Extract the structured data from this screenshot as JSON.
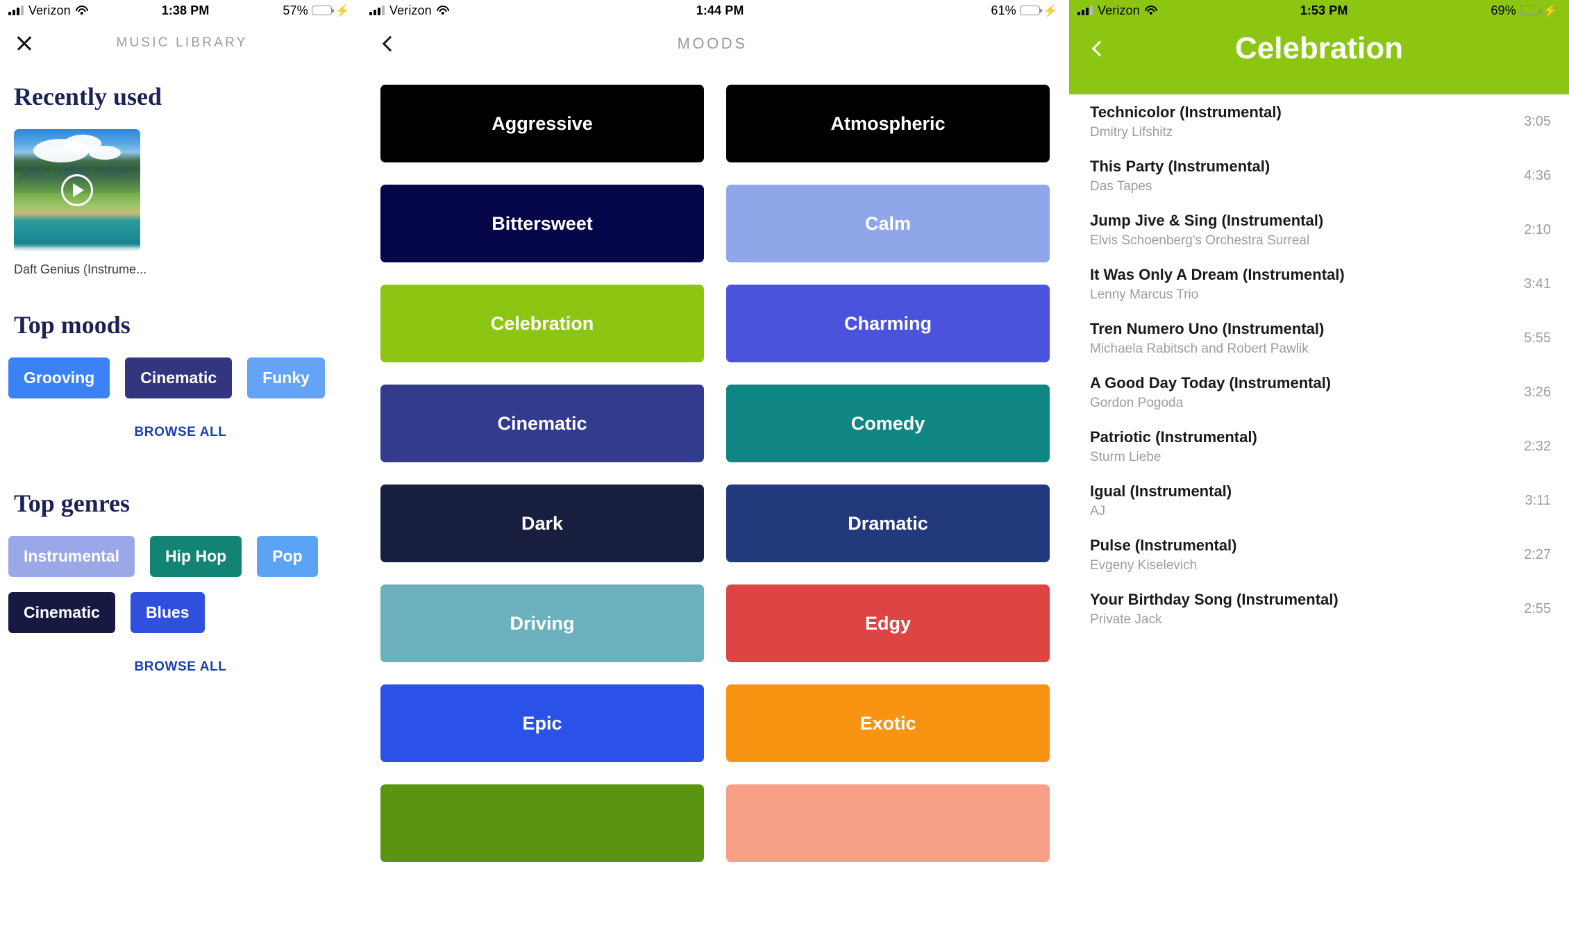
{
  "panels": {
    "library": {
      "status": {
        "carrier": "Verizon",
        "time": "1:38 PM",
        "battery": "57%",
        "battery_level": 57,
        "charging_icon": "⚡"
      },
      "nav": {
        "close_icon": "close-icon",
        "title": "MUSIC LIBRARY"
      },
      "recent": {
        "heading": "Recently used",
        "item_title": "Daft Genius (Instrume...",
        "play_icon": "play-icon"
      },
      "top_moods": {
        "heading": "Top moods",
        "browse_all": "BROWSE ALL",
        "chips": [
          {
            "label": "Grooving",
            "color": "#3b82f6"
          },
          {
            "label": "Cinematic",
            "color": "#33357e"
          },
          {
            "label": "Funky",
            "color": "#64a3f5"
          }
        ]
      },
      "top_genres": {
        "heading": "Top genres",
        "browse_all": "BROWSE ALL",
        "chips": [
          {
            "label": "Instrumental",
            "color": "#9aa8e8"
          },
          {
            "label": "Hip Hop",
            "color": "#138375"
          },
          {
            "label": "Pop",
            "color": "#5ba3f5"
          },
          {
            "label": "Cinematic",
            "color": "#161a42"
          },
          {
            "label": "Blues",
            "color": "#2f4fdc"
          }
        ]
      }
    },
    "moods": {
      "status": {
        "carrier": "Verizon",
        "time": "1:44 PM",
        "battery": "61%",
        "battery_level": 61,
        "charging_icon": "⚡"
      },
      "nav": {
        "back_icon": "chevron-left-icon",
        "title": "MOODS"
      },
      "tiles": [
        {
          "label": "Aggressive",
          "color": "#000000"
        },
        {
          "label": "Atmospheric",
          "color": "#000000"
        },
        {
          "label": "Bittersweet",
          "color": "#050549"
        },
        {
          "label": "Calm",
          "color": "#8fa7e8"
        },
        {
          "label": "Celebration",
          "color": "#8cc613"
        },
        {
          "label": "Charming",
          "color": "#4b53dd"
        },
        {
          "label": "Cinematic",
          "color": "#333b8c"
        },
        {
          "label": "Comedy",
          "color": "#0f8684"
        },
        {
          "label": "Dark",
          "color": "#181e3e"
        },
        {
          "label": "Dramatic",
          "color": "#22397c"
        },
        {
          "label": "Driving",
          "color": "#6cb0bd"
        },
        {
          "label": "Edgy",
          "color": "#dd4444"
        },
        {
          "label": "Epic",
          "color": "#2b52e8"
        },
        {
          "label": "Exotic",
          "color": "#f99312"
        },
        {
          "label": "",
          "color": "#5a9410"
        },
        {
          "label": "",
          "color": "#f79f87"
        }
      ]
    },
    "celebration": {
      "status": {
        "carrier": "Verizon",
        "time": "1:53 PM",
        "battery": "69%",
        "battery_level": 69,
        "charging_icon": "⚡"
      },
      "nav": {
        "back_icon": "chevron-left-icon",
        "title": "Celebration"
      },
      "header_color": "#8cc613",
      "tracks": [
        {
          "title": "Technicolor (Instrumental)",
          "artist": "Dmitry Lifshitz",
          "duration": "3:05"
        },
        {
          "title": "This Party (Instrumental)",
          "artist": "Das Tapes",
          "duration": "4:36"
        },
        {
          "title": "Jump Jive & Sing (Instrumental)",
          "artist": "Elvis Schoenberg's Orchestra Surreal",
          "duration": "2:10"
        },
        {
          "title": "It Was Only A Dream (Instrumental)",
          "artist": "Lenny Marcus Trio",
          "duration": "3:41"
        },
        {
          "title": "Tren Numero Uno (Instrumental)",
          "artist": "Michaela Rabitsch and Robert Pawlik",
          "duration": "5:55"
        },
        {
          "title": "A Good Day Today (Instrumental)",
          "artist": "Gordon Pogoda",
          "duration": "3:26"
        },
        {
          "title": "Patriotic (Instrumental)",
          "artist": "Sturm Liebe",
          "duration": "2:32"
        },
        {
          "title": "Igual (Instrumental)",
          "artist": "AJ",
          "duration": "3:11"
        },
        {
          "title": "Pulse (Instrumental)",
          "artist": "Evgeny Kiselevich",
          "duration": "2:27"
        },
        {
          "title": "Your Birthday Song (Instrumental)",
          "artist": "Private Jack",
          "duration": "2:55"
        }
      ]
    }
  }
}
